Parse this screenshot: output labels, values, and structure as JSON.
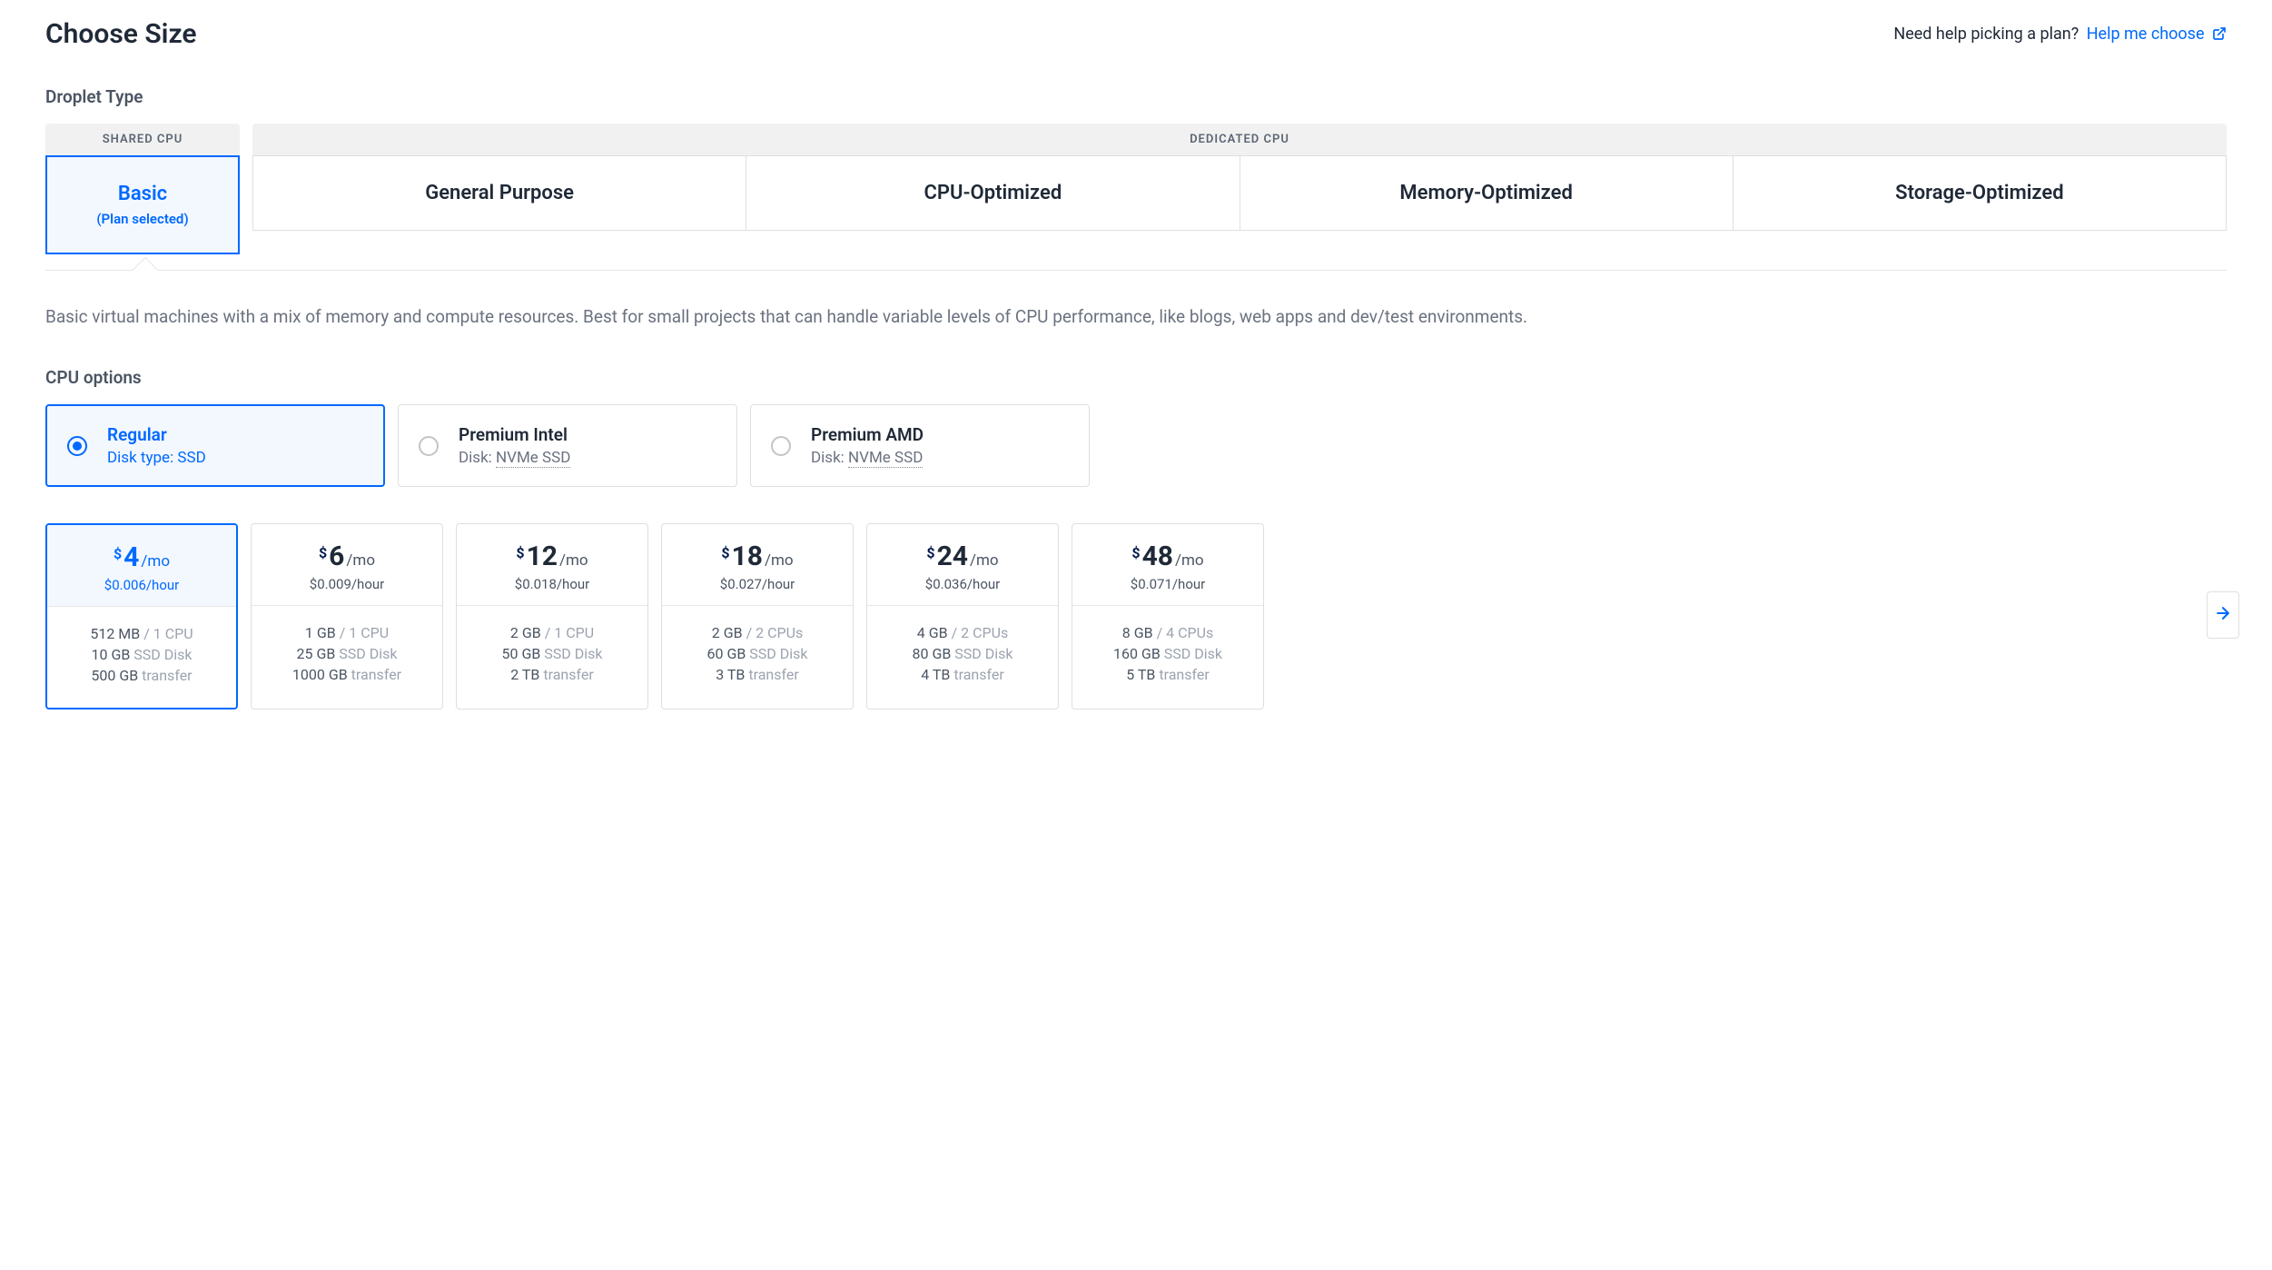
{
  "header": {
    "title": "Choose Size",
    "help_prompt": "Need help picking a plan?",
    "help_link_text": "Help me choose"
  },
  "droplet_type": {
    "label": "Droplet Type",
    "shared_header": "SHARED CPU",
    "dedicated_header": "DEDICATED CPU",
    "shared_options": [
      {
        "name": "Basic",
        "sub": "(Plan selected)"
      }
    ],
    "dedicated_options": [
      {
        "name": "General Purpose"
      },
      {
        "name": "CPU-Optimized"
      },
      {
        "name": "Memory-Optimized"
      },
      {
        "name": "Storage-Optimized"
      }
    ]
  },
  "description": "Basic virtual machines with a mix of memory and compute resources. Best for small projects that can handle variable levels of CPU performance, like blogs, web apps and dev/test environments.",
  "cpu": {
    "label": "CPU options",
    "options": [
      {
        "title": "Regular",
        "sub_prefix": "Disk type: ",
        "sub_value": "SSD",
        "underline": false
      },
      {
        "title": "Premium Intel",
        "sub_prefix": "Disk: ",
        "sub_value": "NVMe SSD",
        "underline": true
      },
      {
        "title": "Premium AMD",
        "sub_prefix": "Disk: ",
        "sub_value": "NVMe SSD",
        "underline": true
      }
    ]
  },
  "plans": [
    {
      "amount": "4",
      "hourly": "$0.006/hour",
      "ram": "512 MB",
      "cpu": " / 1 CPU",
      "disk": "10 GB",
      "disk_label": " SSD Disk",
      "transfer": "500 GB",
      "transfer_label": " transfer"
    },
    {
      "amount": "6",
      "hourly": "$0.009/hour",
      "ram": "1 GB",
      "cpu": " / 1 CPU",
      "disk": "25 GB",
      "disk_label": " SSD Disk",
      "transfer": "1000 GB",
      "transfer_label": " transfer"
    },
    {
      "amount": "12",
      "hourly": "$0.018/hour",
      "ram": "2 GB",
      "cpu": " / 1 CPU",
      "disk": "50 GB",
      "disk_label": " SSD Disk",
      "transfer": "2 TB",
      "transfer_label": " transfer"
    },
    {
      "amount": "18",
      "hourly": "$0.027/hour",
      "ram": "2 GB",
      "cpu": " / 2 CPUs",
      "disk": "60 GB",
      "disk_label": " SSD Disk",
      "transfer": "3 TB",
      "transfer_label": " transfer"
    },
    {
      "amount": "24",
      "hourly": "$0.036/hour",
      "ram": "4 GB",
      "cpu": " / 2 CPUs",
      "disk": "80 GB",
      "disk_label": " SSD Disk",
      "transfer": "4 TB",
      "transfer_label": " transfer"
    },
    {
      "amount": "48",
      "hourly": "$0.071/hour",
      "ram": "8 GB",
      "cpu": " / 4 CPUs",
      "disk": "160 GB",
      "disk_label": " SSD Disk",
      "transfer": "5 TB",
      "transfer_label": " transfer"
    }
  ],
  "price_labels": {
    "dollar": "$",
    "per": "/mo"
  }
}
